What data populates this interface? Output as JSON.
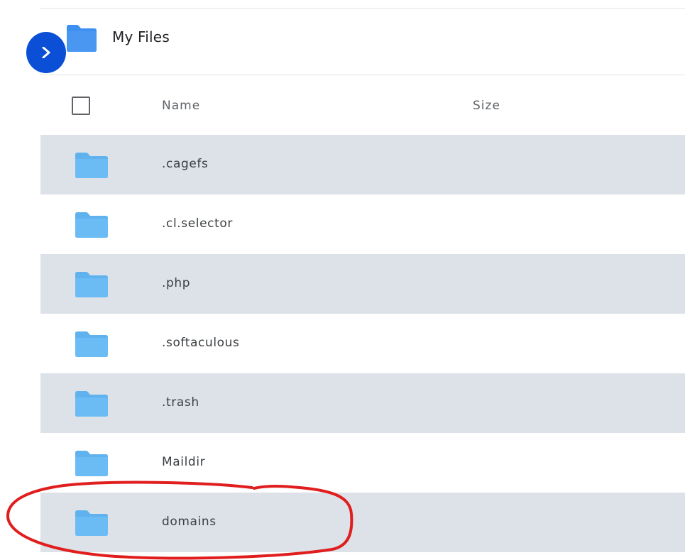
{
  "header": {
    "title": "My Files",
    "folder_icon": "folder-icon",
    "toggle_icon": "chevron-right-icon"
  },
  "table": {
    "columns": {
      "name": "Name",
      "size": "Size"
    },
    "rows": [
      {
        "name": ".cagefs",
        "icon": "folder-icon",
        "size": ""
      },
      {
        "name": ".cl.selector",
        "icon": "folder-icon",
        "size": ""
      },
      {
        "name": ".php",
        "icon": "folder-icon",
        "size": ""
      },
      {
        "name": ".softaculous",
        "icon": "folder-icon",
        "size": ""
      },
      {
        "name": ".trash",
        "icon": "folder-icon",
        "size": ""
      },
      {
        "name": "Maildir",
        "icon": "folder-icon",
        "size": ""
      },
      {
        "name": "domains",
        "icon": "folder-icon",
        "size": ""
      }
    ]
  },
  "colors": {
    "accent": "#0a4fd6",
    "folder": "#6bbcf5",
    "row_shade": "#dde1e8",
    "annotation": "#e01e1e"
  },
  "annotation": {
    "type": "hand-drawn-circle",
    "target": "domains"
  }
}
